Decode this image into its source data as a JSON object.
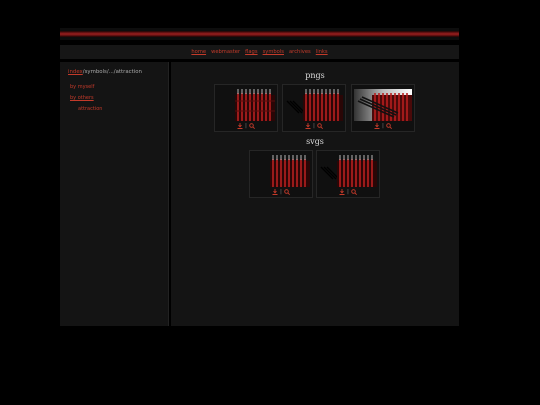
{
  "nav": {
    "items": [
      "home",
      "webmaster",
      "flags",
      "symbols",
      "archives",
      "links"
    ]
  },
  "sidebar": {
    "breadcrumb": {
      "root": "index",
      "path": "/symbols/.../attraction"
    },
    "links": [
      "by myself",
      "by others",
      "attraction"
    ]
  },
  "main": {
    "sections": [
      {
        "title": "pngs"
      },
      {
        "title": "svgs"
      }
    ],
    "action_sep": "|"
  },
  "colors": {
    "accent": "#c43a2a",
    "background": "#000000",
    "panel": "#141414"
  },
  "icons": [
    "download-icon",
    "magnifier-icon"
  ]
}
